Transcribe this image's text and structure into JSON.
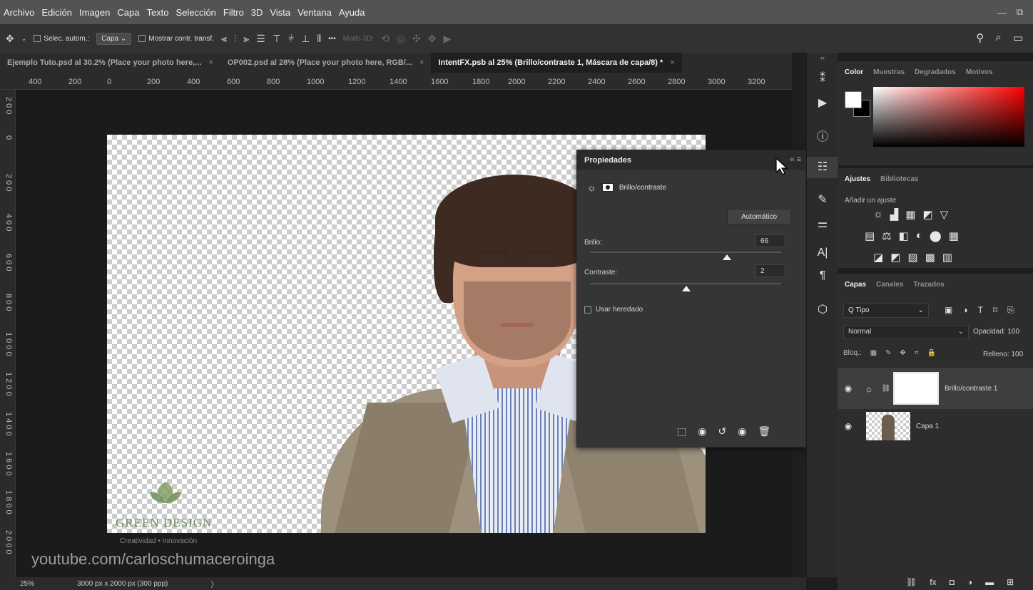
{
  "menu": [
    "Archivo",
    "Edición",
    "Imagen",
    "Capa",
    "Texto",
    "Selección",
    "Filtro",
    "3D",
    "Vista",
    "Ventana",
    "Ayuda"
  ],
  "options": {
    "auto_select_label": "Selec. autom.:",
    "auto_select_value": "Capa",
    "show_transform_label": "Mostrar contr. transf.",
    "more": "•••",
    "mode3d_label": "Modo 3D:"
  },
  "tabs": [
    {
      "label": "Ejemplo Tuto.psd al 30.2% (Place your photo here,...",
      "close": "×"
    },
    {
      "label": "OP002.psd al 28% (Place your photo here, RGB/...",
      "close": "×"
    },
    {
      "label": "IntentFX.psb al 25% (Brillo/contraste 1, Máscara de capa/8) *",
      "close": "×"
    }
  ],
  "ruler_h": [
    "400",
    "200",
    "0",
    "200",
    "400",
    "600",
    "800",
    "1000",
    "1200",
    "1400",
    "1600",
    "1800",
    "2000",
    "2200",
    "2400",
    "2600",
    "2800",
    "3000",
    "3200"
  ],
  "ruler_v": [
    "2 0 0",
    "0",
    "2 0 0",
    "4 0 0",
    "6 0 0",
    "8 0 0",
    "1 0 0 0",
    "1 2 0 0",
    "1 4 0 0",
    "1 6 0 0",
    "1 8 0 0",
    "2 0 0 0"
  ],
  "watermark": {
    "brand": "GREEN DESIGN",
    "tagline": "Creatividad • Innovación",
    "url": "youtube.com/carloschumaceroinga"
  },
  "properties": {
    "title": "Propiedades",
    "adjustment_name": "Brillo/contraste",
    "auto_button": "Automático",
    "brightness_label": "Brillo:",
    "brightness_value": "66",
    "contrast_label": "Contraste:",
    "contrast_value": "2",
    "legacy_label": "Usar heredado"
  },
  "color_panel": {
    "tabs": [
      "Color",
      "Muestras",
      "Degradados",
      "Motivos"
    ],
    "foreground": "#ffffff",
    "background": "#000000"
  },
  "adjustments_panel": {
    "tabs": [
      "Ajustes",
      "Bibliotecas"
    ],
    "add_label": "Añadir un ajuste"
  },
  "layers_panel": {
    "tabs": [
      "Capas",
      "Canales",
      "Trazados"
    ],
    "filter_label": "Q Tipo",
    "blend_mode": "Normal",
    "opacity_label": "Opacidad:",
    "opacity_value": "100",
    "lock_label": "Bloq.:",
    "fill_label": "Relleno:",
    "fill_value": "100",
    "layers": [
      {
        "name": "Brillo/contraste 1",
        "visible": true,
        "selected": true
      },
      {
        "name": "Capa 1",
        "visible": true,
        "selected": false
      }
    ]
  },
  "status": {
    "zoom": "25%",
    "doc_size": "3000 px x 2000 px (300 ppp)",
    "arrow": "〉"
  },
  "icons": [
    "move-icon",
    "search-icon",
    "workspace-icon",
    "play-icon",
    "info-icon",
    "adjustments-icon",
    "brush-icon",
    "text-icon",
    "paragraph-icon",
    "3d-icon",
    "eye-icon",
    "trash-icon"
  ]
}
